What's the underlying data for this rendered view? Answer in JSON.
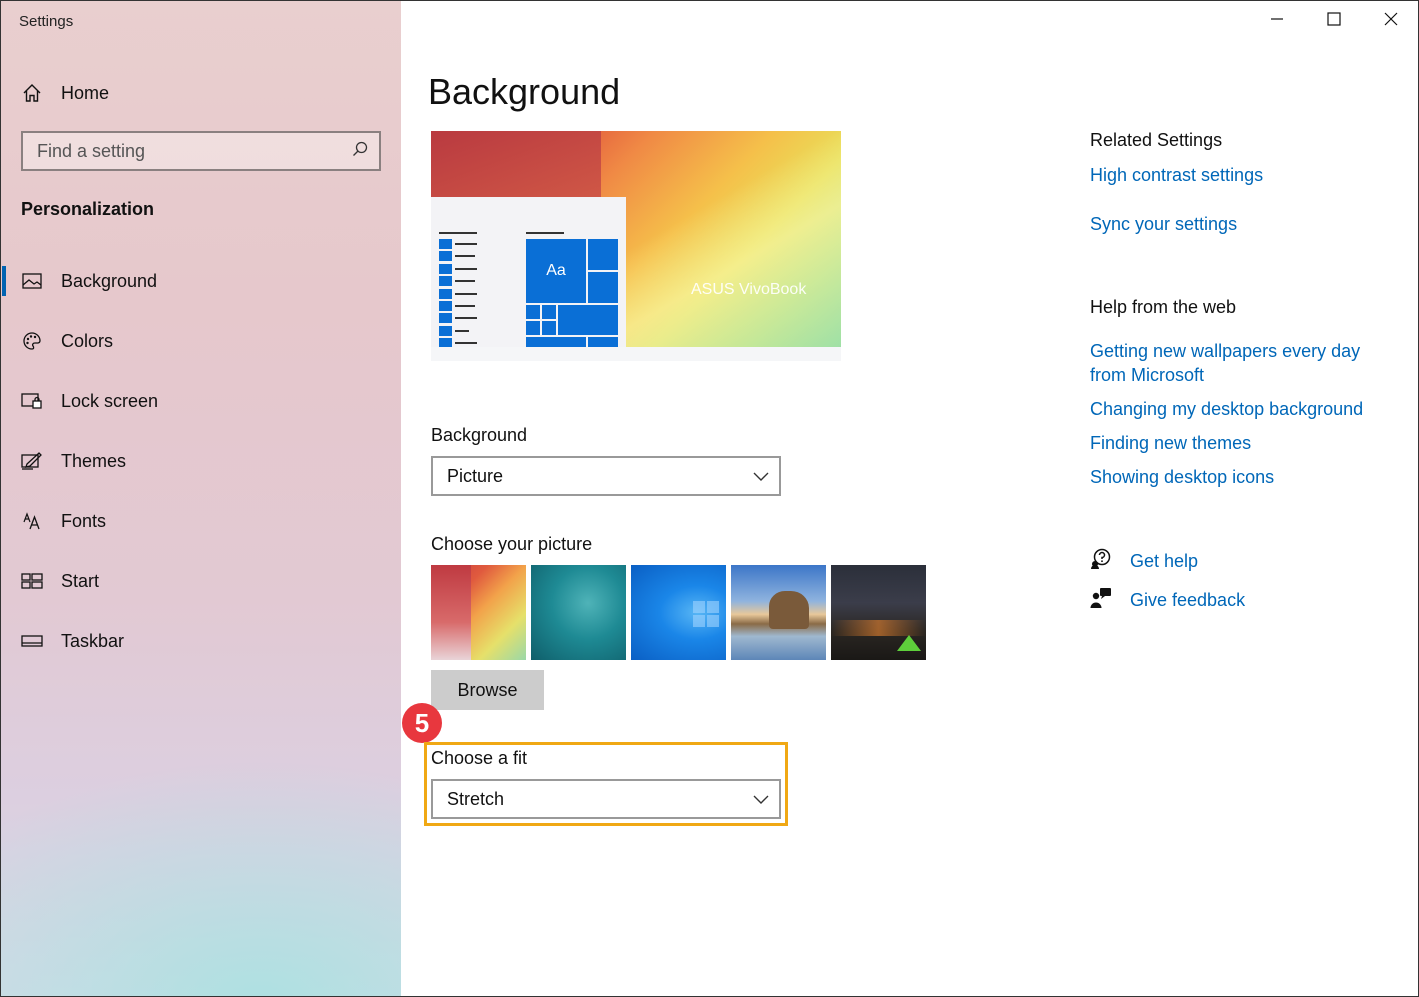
{
  "window": {
    "title": "Settings",
    "controls": {
      "minimize": "minimize-icon",
      "maximize": "maximize-icon",
      "close": "close-icon"
    }
  },
  "sidebar": {
    "home_label": "Home",
    "search_placeholder": "Find a setting",
    "section_title": "Personalization",
    "items": [
      {
        "label": "Background",
        "icon": "picture-icon",
        "active": true
      },
      {
        "label": "Colors",
        "icon": "palette-icon",
        "active": false
      },
      {
        "label": "Lock screen",
        "icon": "lock-screen-icon",
        "active": false
      },
      {
        "label": "Themes",
        "icon": "themes-icon",
        "active": false
      },
      {
        "label": "Fonts",
        "icon": "fonts-icon",
        "active": false
      },
      {
        "label": "Start",
        "icon": "start-icon",
        "active": false
      },
      {
        "label": "Taskbar",
        "icon": "taskbar-icon",
        "active": false
      }
    ]
  },
  "main": {
    "title": "Background",
    "preview": {
      "brand_text": "ASUS VivoBook",
      "tile_text": "Aa"
    },
    "background": {
      "label": "Background",
      "selected": "Picture"
    },
    "picture": {
      "label": "Choose your picture",
      "browse_label": "Browse"
    },
    "fit": {
      "label": "Choose a fit",
      "selected": "Stretch"
    },
    "step_number": "5"
  },
  "related": {
    "title": "Related Settings",
    "links": [
      "High contrast settings",
      "Sync your settings"
    ]
  },
  "help_web": {
    "title": "Help from the web",
    "link_1_line_1": "Getting new wallpapers every day",
    "link_1_line_2": "from Microsoft",
    "links": [
      "Changing my desktop background",
      "Finding new themes",
      "Showing desktop icons"
    ]
  },
  "support": {
    "get_help": "Get help",
    "give_feedback": "Give feedback"
  },
  "colors": {
    "accent": "#0063b1",
    "link": "#0067b8",
    "highlight": "#f0a814",
    "badge": "#e8373e"
  }
}
